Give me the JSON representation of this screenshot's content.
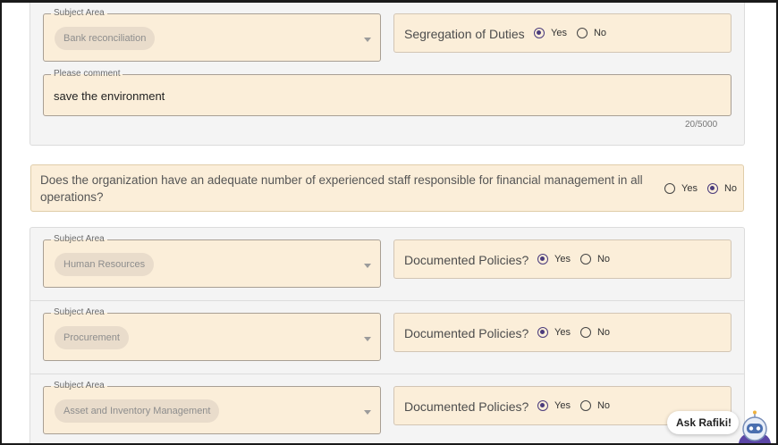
{
  "section1": {
    "subject_area_legend": "Subject Area",
    "subject_area_value": "Bank reconciliation",
    "question": "Segregation of Duties",
    "yes_label": "Yes",
    "no_label": "No",
    "selected": "Yes",
    "comment_legend": "Please comment",
    "comment_value": "save the environment",
    "counter": "20/5000"
  },
  "staff_question": {
    "text": "Does the organization have an adequate number of experienced staff responsible for financial management in all operations?",
    "yes_label": "Yes",
    "no_label": "No",
    "selected": "No"
  },
  "rows": [
    {
      "subject_area_legend": "Subject Area",
      "subject_area_value": "Human Resources",
      "question": "Documented Policies?",
      "yes_label": "Yes",
      "no_label": "No",
      "selected": "Yes"
    },
    {
      "subject_area_legend": "Subject Area",
      "subject_area_value": "Procurement",
      "question": "Documented Policies?",
      "yes_label": "Yes",
      "no_label": "No",
      "selected": "Yes"
    },
    {
      "subject_area_legend": "Subject Area",
      "subject_area_value": "Asset and Inventory Management",
      "question": "Documented Policies?",
      "yes_label": "Yes",
      "no_label": "No",
      "selected": "Yes"
    }
  ],
  "chatbot": {
    "label": "Ask Rafiki!",
    "icon": "robot-icon"
  },
  "colors": {
    "field_bg": "#fbeed9",
    "radio_accent": "#4a3b7c",
    "panel_bg": "#f4f4f4"
  }
}
